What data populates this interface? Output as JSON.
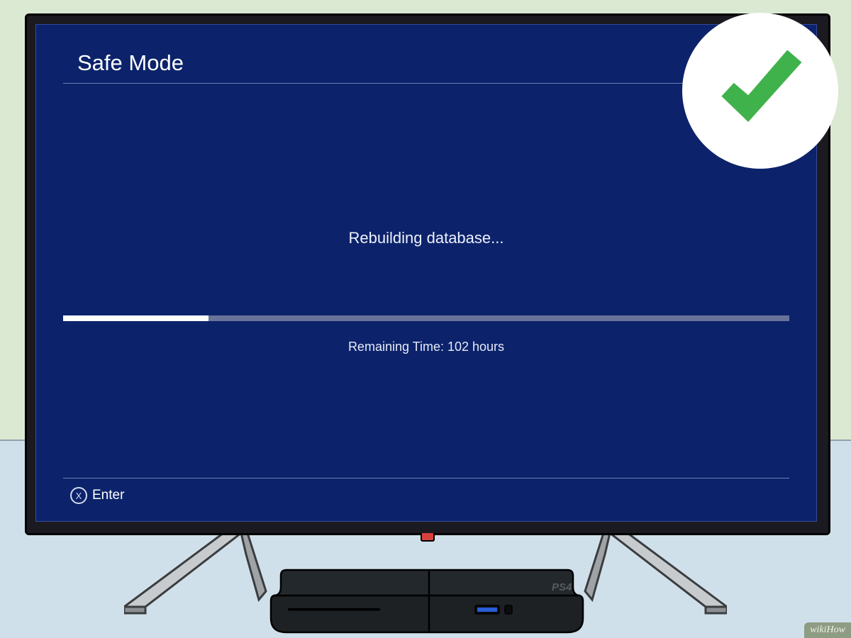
{
  "screen": {
    "title": "Safe Mode",
    "status": "Rebuilding database...",
    "remaining": "Remaining Time: 102 hours",
    "progress_percent": 20,
    "action_icon": "X",
    "action_label": "Enter"
  },
  "watermark": "wikiHow",
  "console_label": "PS4",
  "colors": {
    "screen_bg": "#0c236b",
    "check_green": "#40b24b"
  }
}
